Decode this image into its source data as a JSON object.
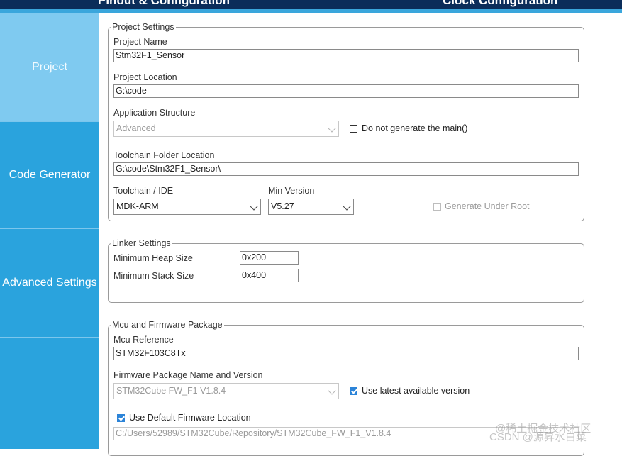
{
  "top_tabs": [
    "Pinout & Configuration",
    "Clock Configuration"
  ],
  "sidebar": {
    "items": [
      {
        "label": "Project",
        "active": true
      },
      {
        "label": "Code Generator",
        "active": false
      },
      {
        "label": "Advanced Settings",
        "active": false
      }
    ]
  },
  "project_settings": {
    "legend": "Project Settings",
    "project_name_label": "Project Name",
    "project_name_value": "Stm32F1_Sensor",
    "project_location_label": "Project Location",
    "project_location_value": "G:\\code",
    "app_structure_label": "Application Structure",
    "app_structure_value": "Advanced",
    "no_main_label": "Do not generate the main()",
    "no_main_checked": false,
    "toolchain_folder_label": "Toolchain Folder Location",
    "toolchain_folder_value": "G:\\code\\Stm32F1_Sensor\\",
    "toolchain_ide_label": "Toolchain / IDE",
    "toolchain_ide_value": "MDK-ARM",
    "min_version_label": "Min Version",
    "min_version_value": "V5.27",
    "gen_under_root_label": "Generate Under Root",
    "gen_under_root_checked": false
  },
  "linker_settings": {
    "legend": "Linker Settings",
    "heap_label": "Minimum Heap Size",
    "heap_value": "0x200",
    "stack_label": "Minimum Stack Size",
    "stack_value": "0x400"
  },
  "mcu_firmware": {
    "legend": "Mcu and Firmware Package",
    "mcu_ref_label": "Mcu Reference",
    "mcu_ref_value": "STM32F103C8Tx",
    "fw_pkg_label": "Firmware Package Name and Version",
    "fw_pkg_value": "STM32Cube FW_F1 V1.8.4",
    "use_latest_label": "Use latest available version",
    "use_latest_checked": true,
    "use_default_loc_label": "Use Default Firmware Location",
    "use_default_loc_checked": true,
    "fw_location_value": "C:/Users/52989/STM32Cube/Repository/STM32Cube_FW_F1_V1.8.4"
  },
  "watermark": {
    "line1": "@稀土掘金技术社区",
    "line2": "CSDN @源昇水白菜"
  }
}
